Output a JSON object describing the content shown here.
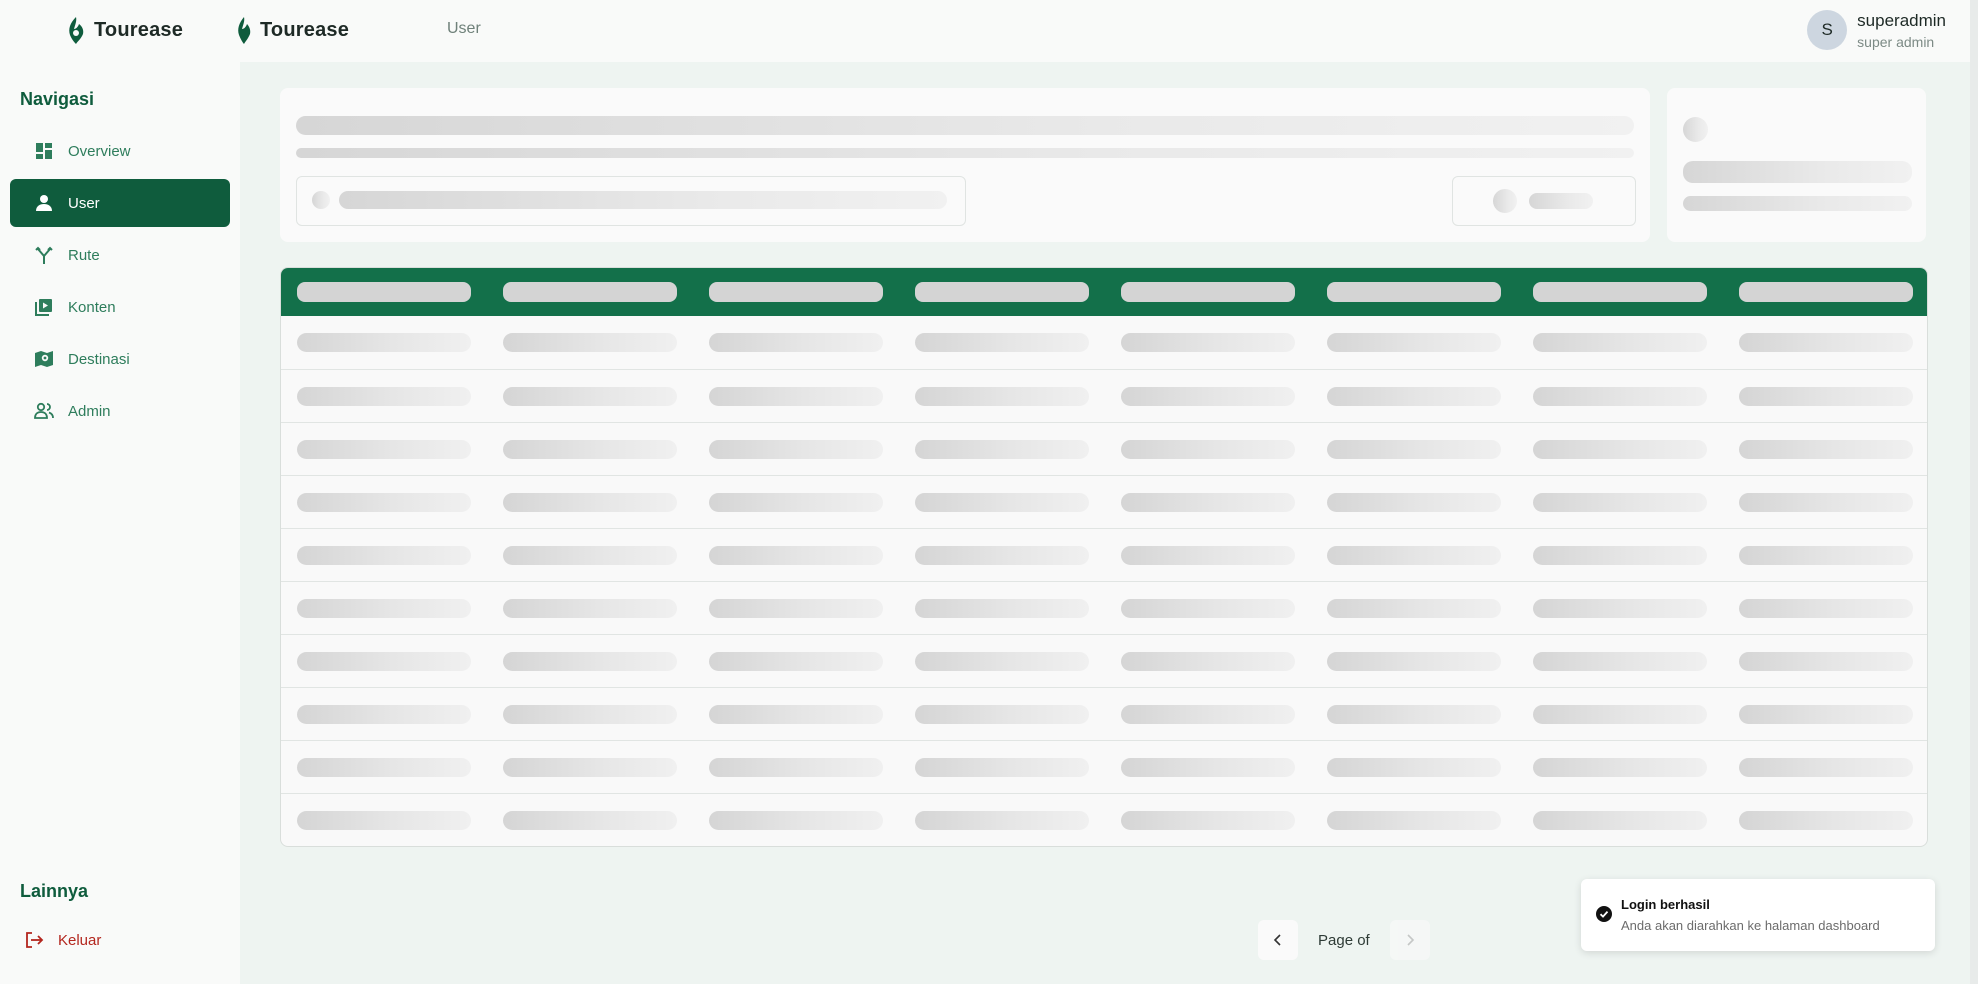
{
  "header": {
    "brand_primary": "Tourease",
    "brand_secondary": "Tourease",
    "breadcrumb": "User",
    "user": {
      "initial": "S",
      "name": "superadmin",
      "role": "super admin"
    }
  },
  "sidebar": {
    "nav_title": "Navigasi",
    "items": [
      {
        "label": "Overview",
        "icon": "dashboard-icon",
        "active": false
      },
      {
        "label": "User",
        "icon": "person-icon",
        "active": true
      },
      {
        "label": "Rute",
        "icon": "route-fork-icon",
        "active": false
      },
      {
        "label": "Konten",
        "icon": "video-library-icon",
        "active": false
      },
      {
        "label": "Destinasi",
        "icon": "map-pin-icon",
        "active": false
      },
      {
        "label": "Admin",
        "icon": "people-icon",
        "active": false
      }
    ],
    "other_title": "Lainnya",
    "logout_label": "Keluar"
  },
  "pagination": {
    "label": "Page of"
  },
  "toast": {
    "title": "Login berhasil",
    "description": "Anda akan diarahkan ke halaman dashboard",
    "icon": "check-circle-icon"
  },
  "colors": {
    "primary": "#0f5c3d",
    "table_header": "#13704a",
    "danger": "#b3261e",
    "main_bg": "#eef4f1"
  }
}
